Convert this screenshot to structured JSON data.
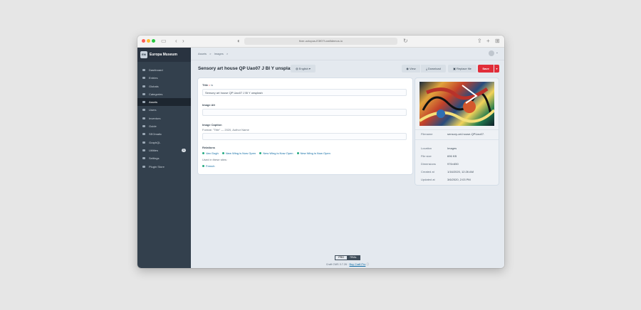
{
  "browser": {
    "url": "fiver-octopus-E3f07f.craftdemos.io"
  },
  "sidebar": {
    "site_logo_text": "EM",
    "site_name": "Europa Museum",
    "items": [
      {
        "label": "Dashboard",
        "icon": "gauge-icon"
      },
      {
        "label": "Entries",
        "icon": "newspaper-icon"
      },
      {
        "label": "Globals",
        "icon": "globe-icon"
      },
      {
        "label": "Categories",
        "icon": "sitemap-icon"
      },
      {
        "label": "Assets",
        "icon": "image-icon",
        "active": true
      },
      {
        "label": "Users",
        "icon": "users-icon"
      },
      {
        "label": "Inventors",
        "icon": "lightbulb-icon"
      },
      {
        "label": "Guide",
        "icon": "book-icon"
      },
      {
        "label": "SEOmatic",
        "icon": "seo-icon"
      },
      {
        "label": "GraphQL",
        "icon": "graphql-icon"
      },
      {
        "label": "Utilities",
        "icon": "wrench-icon",
        "badge": "1"
      },
      {
        "label": "Settings",
        "icon": "gear-icon"
      },
      {
        "label": "Plugin Store",
        "icon": "plug-icon"
      }
    ]
  },
  "header": {
    "breadcrumbs": [
      "Assets",
      ">",
      "Images",
      ">"
    ],
    "page_title": "Sensory art house QP Uao07 J Bl Y unsplash",
    "site_select": "English",
    "view_label": "View",
    "download_label": "Download",
    "replace_label": "Replace file",
    "save_label": "Save",
    "save_menu": "▾"
  },
  "form": {
    "title_label": "Title",
    "title_value": "Sensory art house QP Uao07 J Bl Y unsplash",
    "alt_label": "Image Alt",
    "caption_label": "Image Caption",
    "caption_hint": "Format: \"Title\" — 2020, Author Name",
    "relations_label": "Relations",
    "relations": [
      "Van Gogh",
      "New Wing is Now Open",
      "New Wing is Now Open",
      "New Wing is Now Open"
    ],
    "used_label": "Used in these sites:",
    "used_site": "French"
  },
  "meta": {
    "filename_label": "Filename",
    "filename_value": "sensory-art-house-QPUao07.",
    "location_label": "Location",
    "location_value": "Images",
    "filesize_label": "File size",
    "filesize_value": "696 KB",
    "dimensions_label": "Dimensions",
    "dimensions_value": "976×650",
    "created_label": "Created at",
    "created_value": "1/16/2020, 12:26 AM",
    "updated_label": "Updated at",
    "updated_value": "3/6/2020, 2:03 PM"
  },
  "footer": {
    "badge_left": "PRO",
    "badge_right": "TRIAL",
    "version": "Craft CMS 3.7.26",
    "buy_link": "Buy Craft Pro"
  }
}
